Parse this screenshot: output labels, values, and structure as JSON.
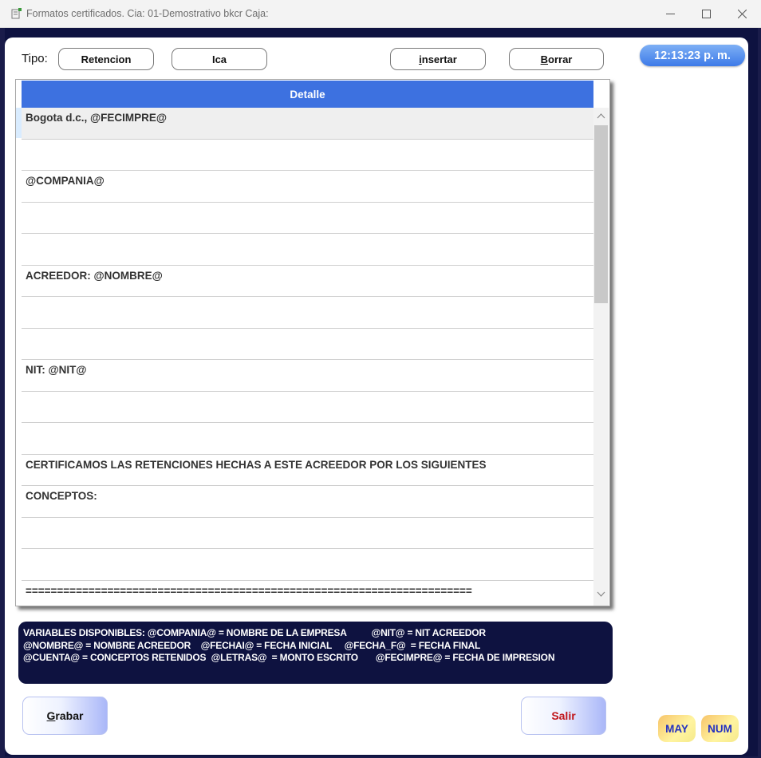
{
  "window": {
    "title": "Formatos certificados. Cia: 01-Demostrativo bkcr  Caja:",
    "controls": [
      "minimize-icon",
      "maximize-icon",
      "close-icon"
    ]
  },
  "toolbar": {
    "tipo_label": "Tipo:",
    "retencion_label": "Retencion",
    "ica_label": "Ica",
    "insertar_prefix": "i",
    "insertar_rest": "nsertar",
    "borrar_prefix": "B",
    "borrar_rest": "orrar"
  },
  "clock": "12:13:23 p. m.",
  "grid": {
    "header": "Detalle",
    "rows": [
      "Bogota d.c., @FECIMPRE@",
      "",
      "@COMPANIA@",
      "",
      "",
      "ACREEDOR: @NOMBRE@",
      "",
      "",
      "NIT: @NIT@",
      "",
      "",
      "CERTIFICAMOS LAS RETENCIONES HECHAS A ESTE ACREEDOR POR LOS SIGUIENTES",
      "CONCEPTOS:",
      "",
      "",
      "======================================================================="
    ]
  },
  "variables": {
    "line1": "VARIABLES DISPONIBLES: @COMPANIA@ = NOMBRE DE LA EMPRESA          @NIT@ = NIT ACREEDOR",
    "line2": "@NOMBRE@ = NOMBRE ACREEDOR    @FECHAI@ = FECHA INICIAL     @FECHA_F@  = FECHA FINAL",
    "line3": "@CUENTA@ = CONCEPTOS RETENIDOS  @LETRAS@  = MONTO ESCRITO       @FECIMPRE@ = FECHA DE IMPRESION"
  },
  "actions": {
    "grabar_prefix": "G",
    "grabar_rest": "rabar",
    "salir_label": "Salir"
  },
  "indicators": {
    "may": "MAY",
    "num": "NUM"
  },
  "colors": {
    "frame": "#0e1240",
    "header": "#3d71e0",
    "clock": "#3d7ae8",
    "salir_text": "#c0141a",
    "indicator_text": "#2431c0"
  }
}
